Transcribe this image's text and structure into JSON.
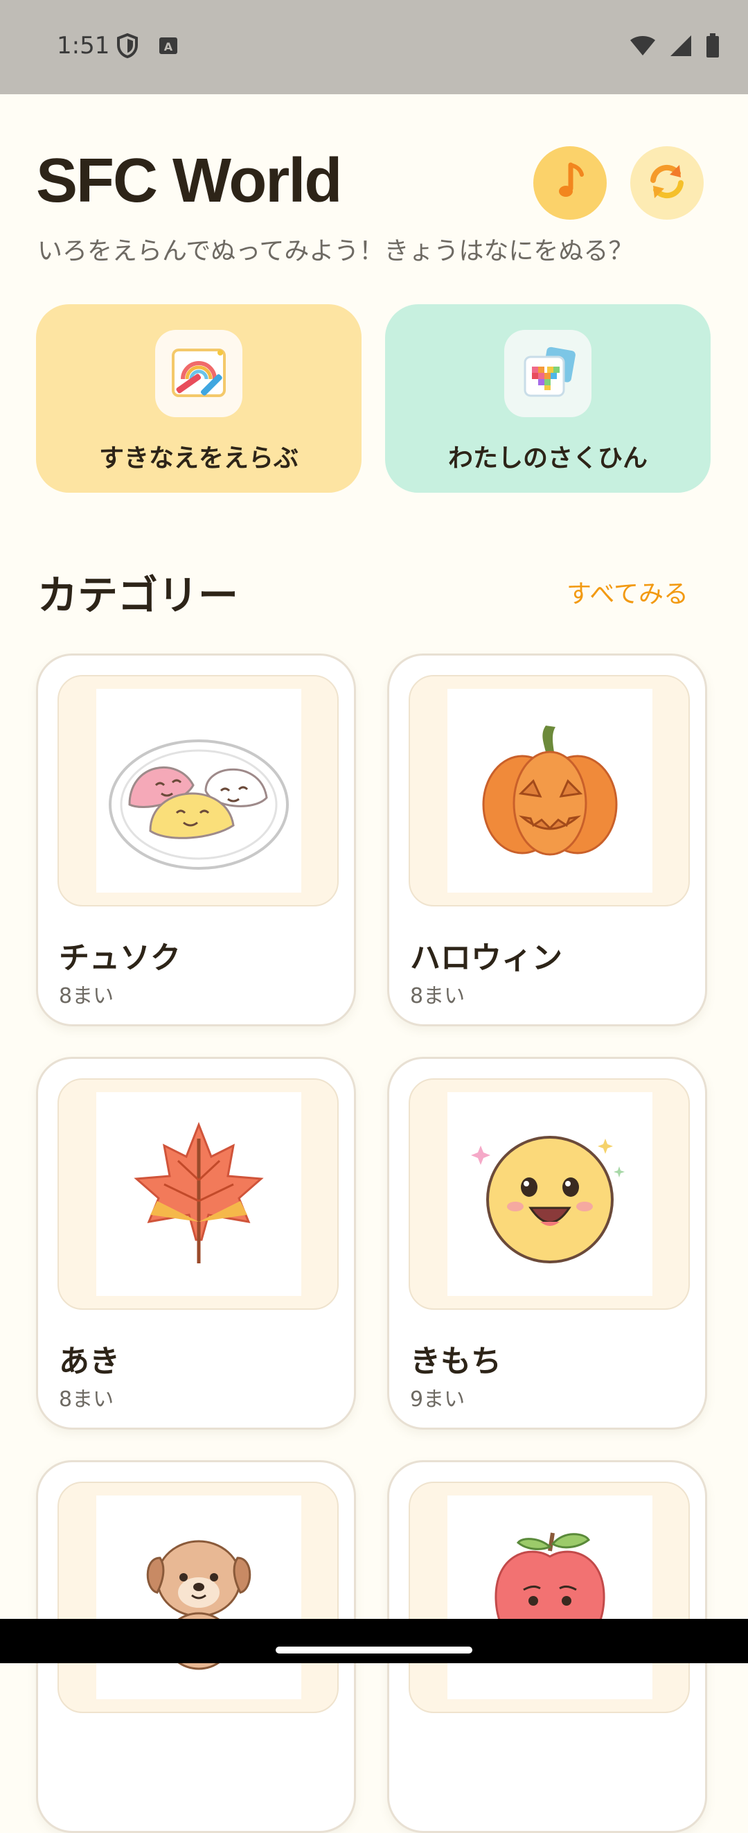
{
  "status_bar": {
    "time": "1:51"
  },
  "header": {
    "title": "SFC World",
    "subtitle": "いろをえらんでぬってみよう！きょうはなにをぬる？",
    "music_icon": "music-note-icon",
    "refresh_icon": "refresh-icon"
  },
  "actions": [
    {
      "label": "すきなえをえらぶ",
      "icon": "rainbow-crayon-icon",
      "color": "#FDE4A2"
    },
    {
      "label": "わたしのさくひん",
      "icon": "pixel-heart-gallery-icon",
      "color": "#C7F0DF"
    }
  ],
  "categories_section": {
    "title": "カテゴリー",
    "see_all": "すべてみる"
  },
  "categories": [
    {
      "name": "チュソク",
      "count": "8まい",
      "image": "songpyeon-rice-cakes"
    },
    {
      "name": "ハロウィン",
      "count": "8まい",
      "image": "jack-o-lantern"
    },
    {
      "name": "あき",
      "count": "8まい",
      "image": "maple-leaf"
    },
    {
      "name": "きもち",
      "count": "9まい",
      "image": "happy-face"
    },
    {
      "name": "",
      "count": "",
      "image": "puppy"
    },
    {
      "name": "",
      "count": "",
      "image": "apple"
    }
  ],
  "colors": {
    "accent": "#F29A12",
    "background": "#FFFDF5",
    "music_button": "#FBD26A"
  }
}
